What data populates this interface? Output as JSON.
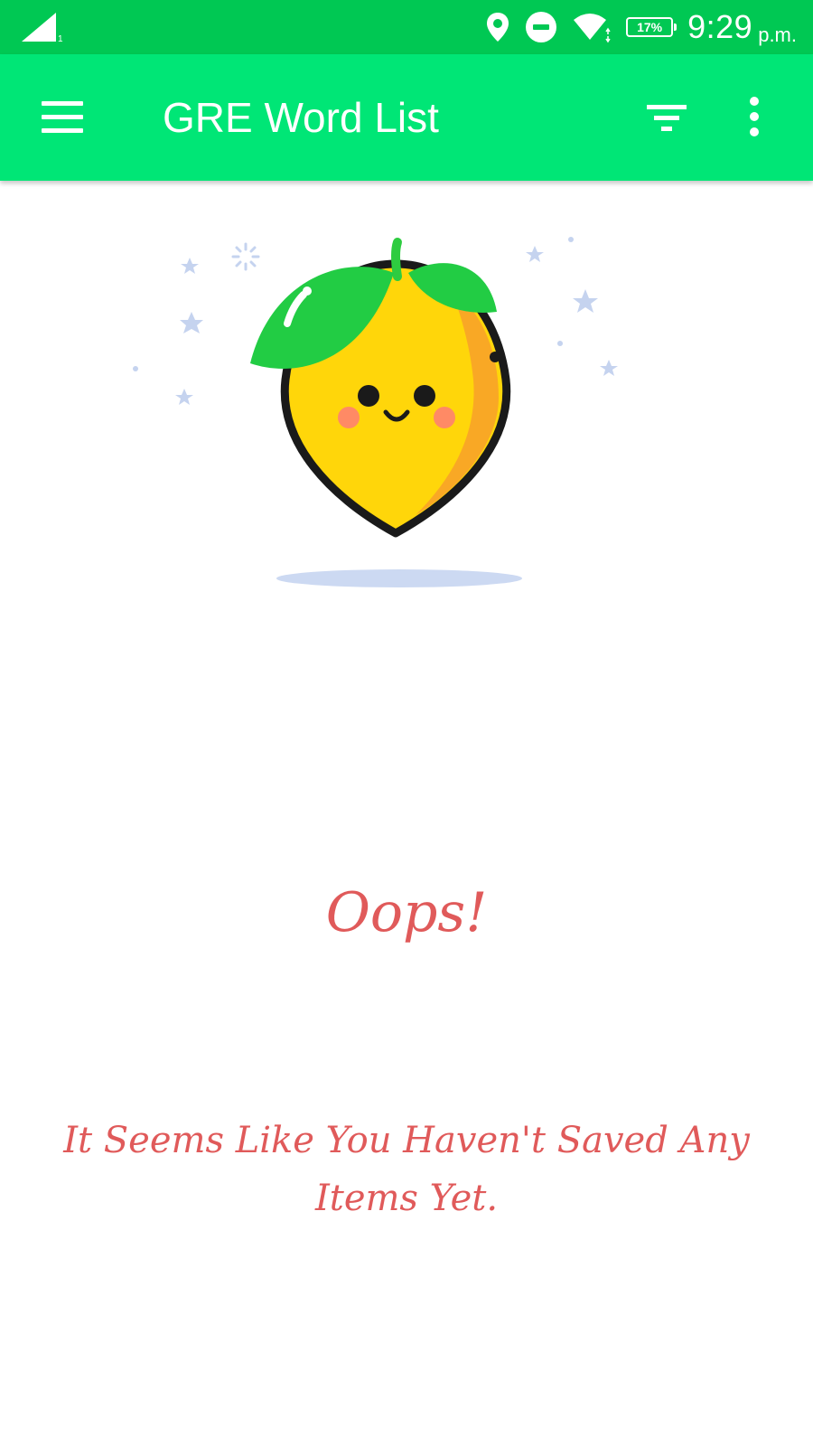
{
  "status_bar": {
    "time": "9:29",
    "time_suffix": "p.m.",
    "battery_percent": "17%",
    "icons": [
      "signal-icon",
      "location-icon",
      "do-not-disturb-icon",
      "wifi-icon",
      "battery-icon"
    ]
  },
  "app_bar": {
    "title": "GRE Word List",
    "icons": [
      "menu-icon",
      "filter-icon",
      "more-vert-icon"
    ],
    "background_color": "#00e676",
    "status_color": "#00c853"
  },
  "empty_state": {
    "illustration": "lemon-icon",
    "heading": "Oops!",
    "message": "It Seems Like You Haven't Saved Any Items Yet.",
    "text_color": "#e05a5a"
  }
}
